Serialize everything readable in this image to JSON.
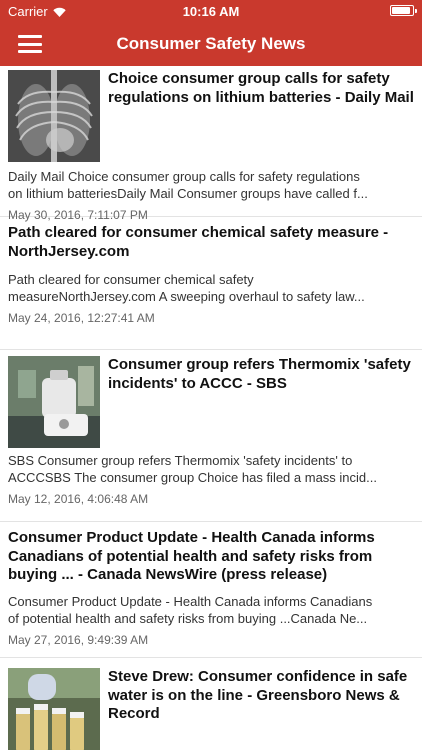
{
  "status": {
    "carrier": "Carrier",
    "time": "10:16 AM",
    "battery_level": 1.0
  },
  "nav": {
    "title": "Consumer Safety News"
  },
  "articles": [
    {
      "headline": "Choice consumer group calls for safety regulations on lithium batteries - Daily Mail",
      "summary_line1": "Daily Mail   Choice consumer group calls for safety regulations",
      "summary_line2": "on lithium batteriesDaily Mail  Consumer groups have called f...",
      "date": "May 30, 2016, 7:11:07 PM",
      "thumbnail": "xray-image"
    },
    {
      "headline": "Path cleared for consumer chemical safety measure - NorthJersey.com",
      "summary_line1": "Path cleared for consumer chemical safety",
      "summary_line2": "measureNorthJersey.com  A sweeping overhaul to safety law...",
      "date": "May 24, 2016, 12:27:41 AM"
    },
    {
      "headline": "Consumer group refers Thermomix 'safety incidents' to ACCC - SBS",
      "summary_line1": "SBS    Consumer group refers Thermomix 'safety incidents' to",
      "summary_line2": "ACCCSBS  The consumer group Choice has filed a mass incid...",
      "date": "May 12, 2016, 4:06:48 AM",
      "thumbnail": "kitchen-appliance-image"
    },
    {
      "headline": "Consumer Product Update - Health Canada informs Canadians of potential health and safety risks from buying ... - Canada NewsWire (press release)",
      "summary_line1": "Consumer Product Update - Health Canada informs Canadians",
      "summary_line2": "of potential health and safety risks from buying ...Canada Ne...",
      "date": "May 27, 2016, 9:49:39 AM"
    },
    {
      "headline": "Steve Drew: Consumer confidence in safe water is on the line - Greensboro News & Record",
      "thumbnail": "lab-vials-image"
    }
  ]
}
